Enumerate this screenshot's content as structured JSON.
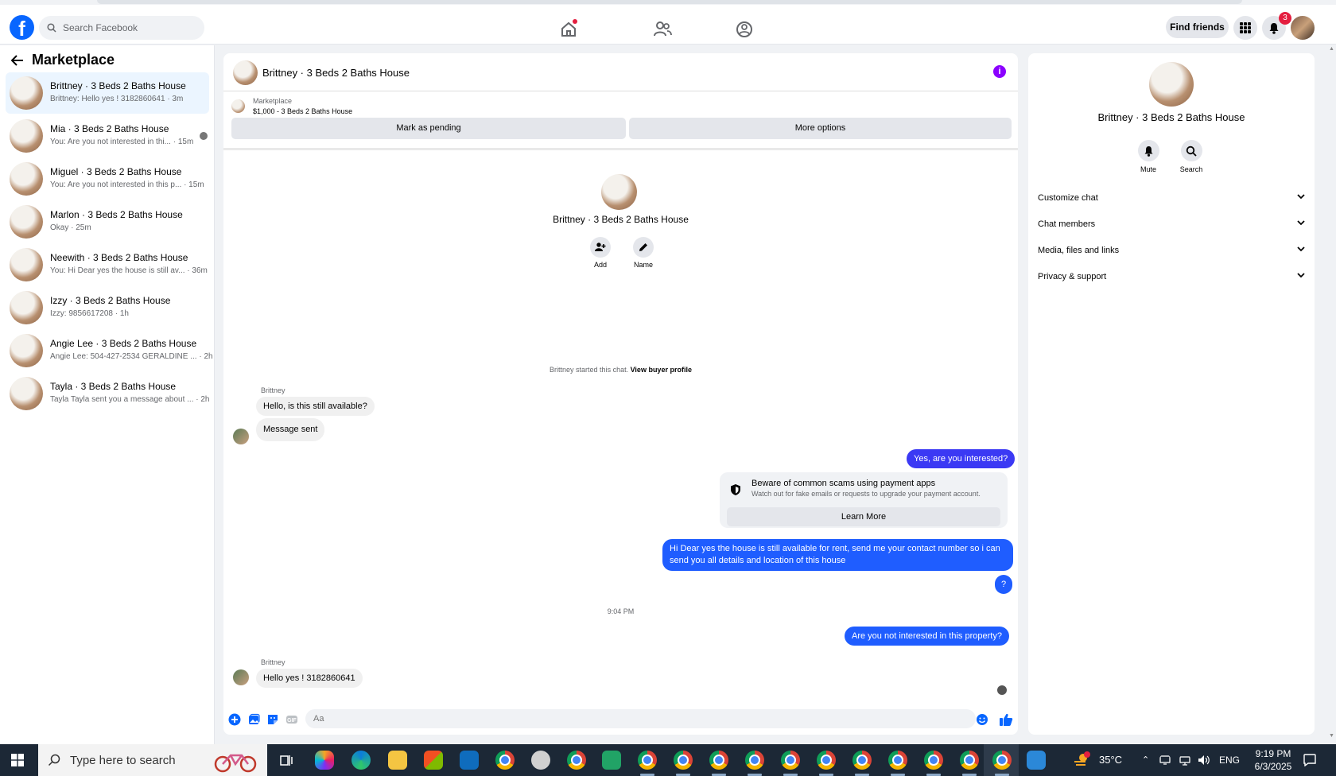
{
  "search": {
    "placeholder": "Search Facebook"
  },
  "topbar": {
    "logo_letter": "f",
    "find_friends": "Find friends",
    "notification_count": "3"
  },
  "sidebar": {
    "title": "Marketplace",
    "conversations": [
      {
        "name": "Brittney · 3 Beds 2 Baths House",
        "preview": "Brittney: Hello yes ! 3182860641 · 3m",
        "active": true
      },
      {
        "name": "Mia · 3 Beds 2 Baths House",
        "preview": "You: Are you not interested in thi... · 15m"
      },
      {
        "name": "Miguel · 3 Beds 2 Baths House",
        "preview": "You: Are you not interested in this p... · 15m"
      },
      {
        "name": "Marlon · 3 Beds 2 Baths House",
        "preview": "Okay · 25m"
      },
      {
        "name": "Neewith · 3 Beds 2 Baths House",
        "preview": "You: Hi Dear yes the house is still av... · 36m"
      },
      {
        "name": "Izzy · 3 Beds 2 Baths House",
        "preview": "Izzy: 9856617208 · 1h"
      },
      {
        "name": "Angie Lee · 3 Beds 2 Baths House",
        "preview": "Angie Lee: 504-427-2534 GERALDINE ... · 2h"
      },
      {
        "name": "Tayla · 3 Beds 2 Baths House",
        "preview": "Tayla Tayla sent you a message about ... · 2h"
      }
    ]
  },
  "chat": {
    "header_title": "Brittney · 3 Beds 2 Baths House",
    "info_glyph": "i",
    "marketplace_label": "Marketplace",
    "listing": "$1,000 - 3 Beds 2 Baths House",
    "mark_pending": "Mark as pending",
    "more_options": "More options",
    "intro_title": "Brittney · 3 Beds 2 Baths House",
    "intro_add": "Add",
    "intro_name": "Name",
    "started_text": "Brittney started this chat.",
    "view_profile": "View buyer profile",
    "sender": "Brittney",
    "msg1": "Hello, is this still available?",
    "msg2": "Message sent",
    "out1": "Yes, are you interested?",
    "scam_title": "Beware of common scams using payment apps",
    "scam_sub": "Watch out for fake emails or requests to upgrade your payment account.",
    "learn_more": "Learn More",
    "out2": "Hi Dear yes the house is still available for rent, send me your contact number so i can send you all details and location of this house",
    "out3": "?",
    "time": "9:04 PM",
    "out4": "Are you not interested in this property?",
    "msg3": "Hello yes ! 3182860641",
    "composer_placeholder": "Aa"
  },
  "rpanel": {
    "title": "Brittney · 3 Beds 2 Baths House",
    "mute": "Mute",
    "search": "Search",
    "rows": [
      "Customize chat",
      "Chat members",
      "Media, files and links",
      "Privacy & support"
    ]
  },
  "taskbar": {
    "search_placeholder": "Type here to search",
    "temp": "35°C",
    "lang": "ENG",
    "time": "9:19 PM",
    "date": "6/3/2025"
  }
}
